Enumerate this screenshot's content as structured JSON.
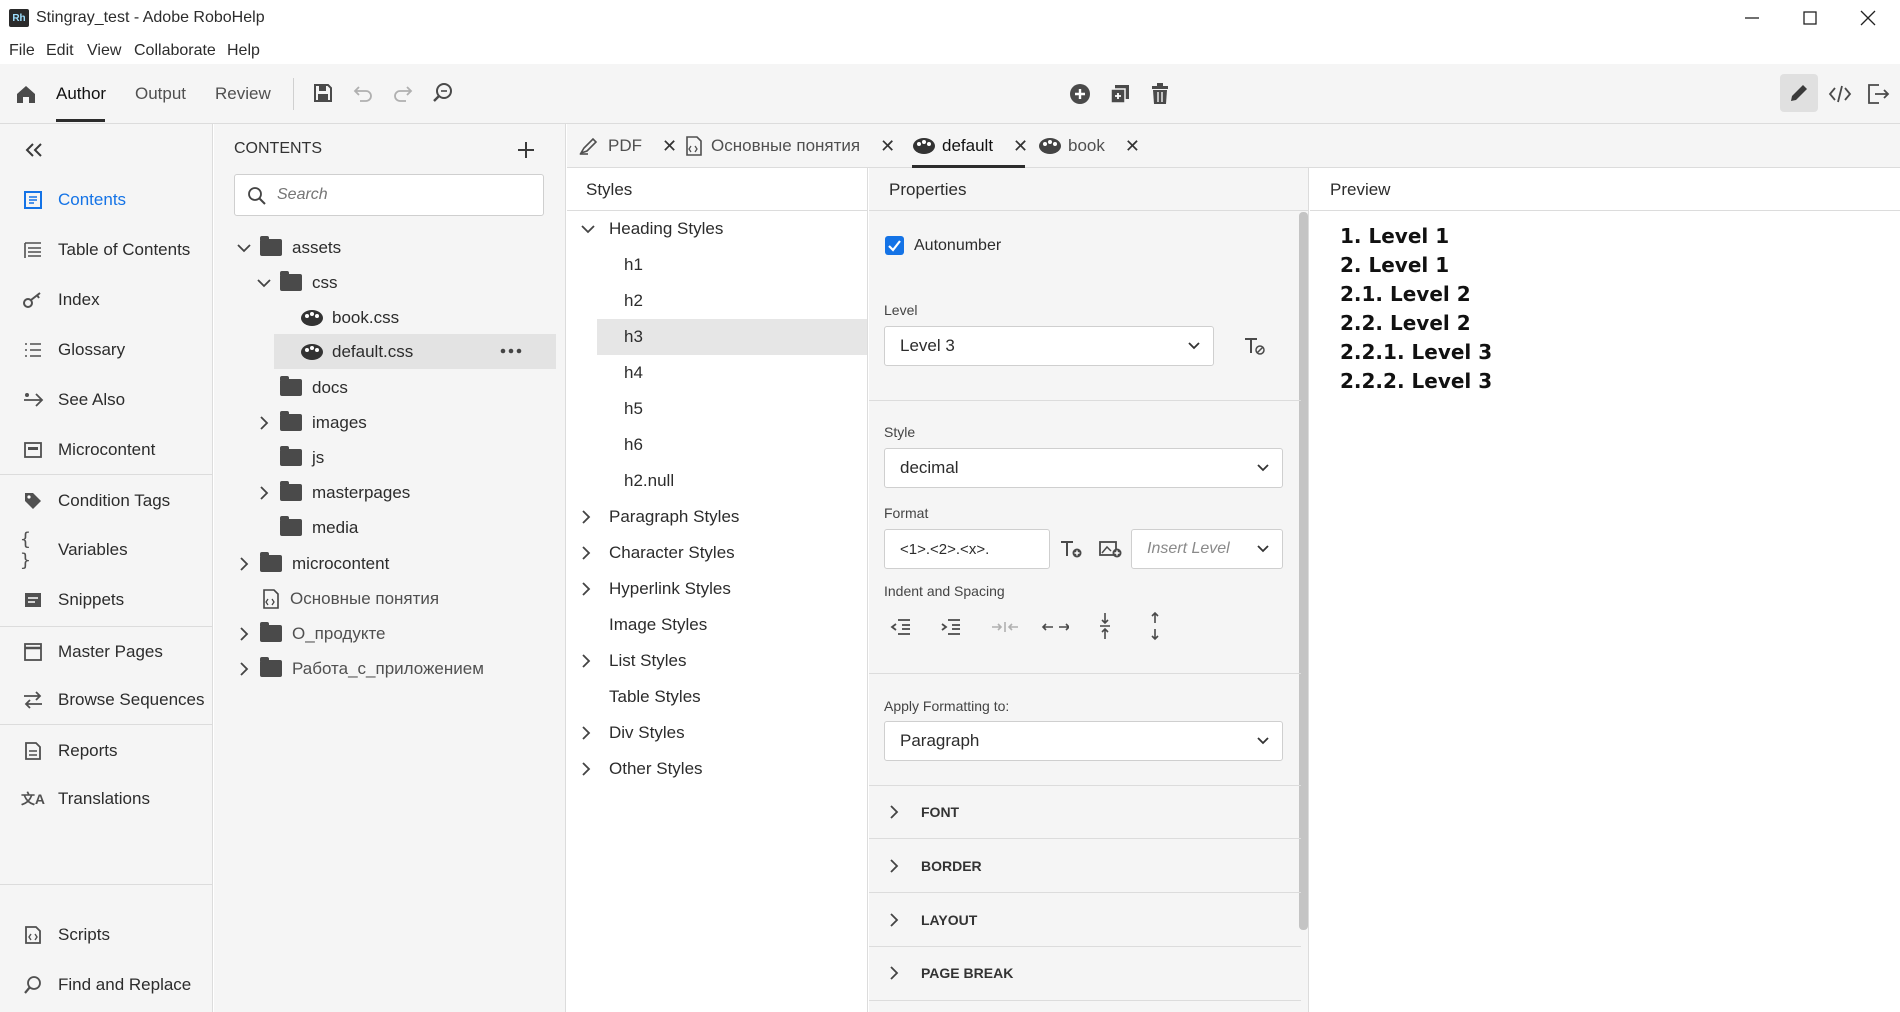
{
  "window": {
    "title": "Stingray_test - Adobe RoboHelp",
    "app_icon": "Rh"
  },
  "menu": [
    "File",
    "Edit",
    "View",
    "Collaborate",
    "Help"
  ],
  "toolbar": {
    "tabs": [
      "Author",
      "Output",
      "Review"
    ],
    "active_tab": "Author"
  },
  "nav": {
    "items": [
      "Contents",
      "Table of Contents",
      "Index",
      "Glossary",
      "See Also",
      "Microcontent",
      "Condition Tags",
      "Variables",
      "Snippets",
      "Master Pages",
      "Browse Sequences",
      "Reports",
      "Translations",
      "Scripts",
      "Find and Replace"
    ],
    "active": "Contents"
  },
  "contents": {
    "title": "CONTENTS",
    "search_placeholder": "Search",
    "tree": [
      "assets",
      "css",
      "book.css",
      "default.css",
      "docs",
      "images",
      "js",
      "masterpages",
      "media",
      "microcontent",
      "Основные понятия",
      "О_продукте",
      "Работа_с_приложением"
    ],
    "selected": "default.css"
  },
  "tabs": [
    "PDF",
    "Основные понятия",
    "default",
    "book"
  ],
  "active_tab": "default",
  "styles": {
    "header": "Styles",
    "heading_group": "Heading Styles",
    "headings": [
      "h1",
      "h2",
      "h3",
      "h4",
      "h5",
      "h6",
      "h2.null"
    ],
    "selected": "h3",
    "groups": [
      "Paragraph Styles",
      "Character Styles",
      "Hyperlink Styles",
      "Image Styles",
      "List Styles",
      "Table Styles",
      "Div Styles",
      "Other Styles"
    ]
  },
  "properties": {
    "header": "Properties",
    "autonumber_label": "Autonumber",
    "autonumber_checked": true,
    "level_label": "Level",
    "level_value": "Level 3",
    "style_label": "Style",
    "style_value": "decimal",
    "format_label": "Format",
    "format_value": "<1>.<2>.<x>.",
    "insert_level_placeholder": "Insert Level",
    "indent_label": "Indent and Spacing",
    "apply_label": "Apply Formatting to:",
    "apply_value": "Paragraph",
    "sections": [
      "FONT",
      "BORDER",
      "LAYOUT",
      "PAGE BREAK"
    ]
  },
  "preview": {
    "header": "Preview",
    "lines": [
      "1. Level 1",
      "2. Level 1",
      "2.1. Level 2",
      "2.2. Level 2",
      "2.2.1. Level 3",
      "2.2.2. Level 3"
    ]
  },
  "colors": {
    "accent": "#1473e6",
    "nav_active": "#1473e6",
    "panel_bg": "#f5f5f5"
  }
}
